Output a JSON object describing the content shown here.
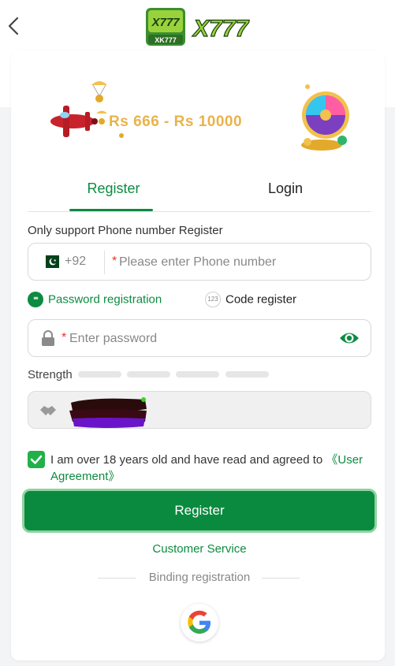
{
  "header": {
    "logo_text_1": "X777",
    "logo_text_2": "XK777",
    "logo_text_3": "X777"
  },
  "banner": {
    "promo_text": "Rs 666 - Rs 10000"
  },
  "tabs": [
    {
      "label": "Register",
      "active": true
    },
    {
      "label": "Login",
      "active": false
    }
  ],
  "form": {
    "support_text": "Only support Phone number Register",
    "phone": {
      "country_code": "+92",
      "required_mark": "*",
      "placeholder": "Please enter Phone number",
      "value": ""
    },
    "methods": {
      "password_label": "Password registration",
      "password_icon_text": "**",
      "code_label": "Code register",
      "code_icon_text": "123"
    },
    "password": {
      "required_mark": "*",
      "placeholder": "Enter password",
      "value": ""
    },
    "strength_label": "Strength",
    "strength_level": 0,
    "invite_code": {
      "value": ""
    }
  },
  "agreement": {
    "checked": true,
    "text": "I am over 18 years old and have read and agreed to ",
    "link_text": "《User Agreement》"
  },
  "register_button": "Register",
  "customer_service": "Customer Service",
  "binding_label": "Binding registration",
  "colors": {
    "brand_green": "#0d8b41",
    "button_green": "#0a8a3e",
    "checkbox_green": "#22b04b",
    "required_red": "#e5352b"
  },
  "icons": [
    "chevron-left-icon",
    "pakistan-flag-icon",
    "lock-icon",
    "eye-icon",
    "handshake-icon",
    "check-icon",
    "google-icon"
  ]
}
